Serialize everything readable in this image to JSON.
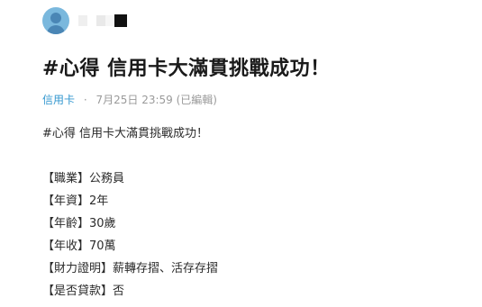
{
  "post": {
    "title": "#心得 信用卡大滿貫挑戰成功！",
    "board": "信用卡",
    "separator": "·",
    "timestamp": "7月25日 23:59 (已編輯)",
    "body_first_line": "#心得 信用卡大滿貫挑戰成功！",
    "body_lines": [
      "【職業】公務員",
      "【年資】2年",
      "【年齡】30歲",
      "【年收】70萬",
      "【財力證明】薪轉存摺、活存存摺",
      "【是否貸款】否"
    ]
  },
  "colors": {
    "board_link": "#3397cf",
    "meta_text": "#9a9a9a",
    "avatar": "#7ab8dd"
  }
}
